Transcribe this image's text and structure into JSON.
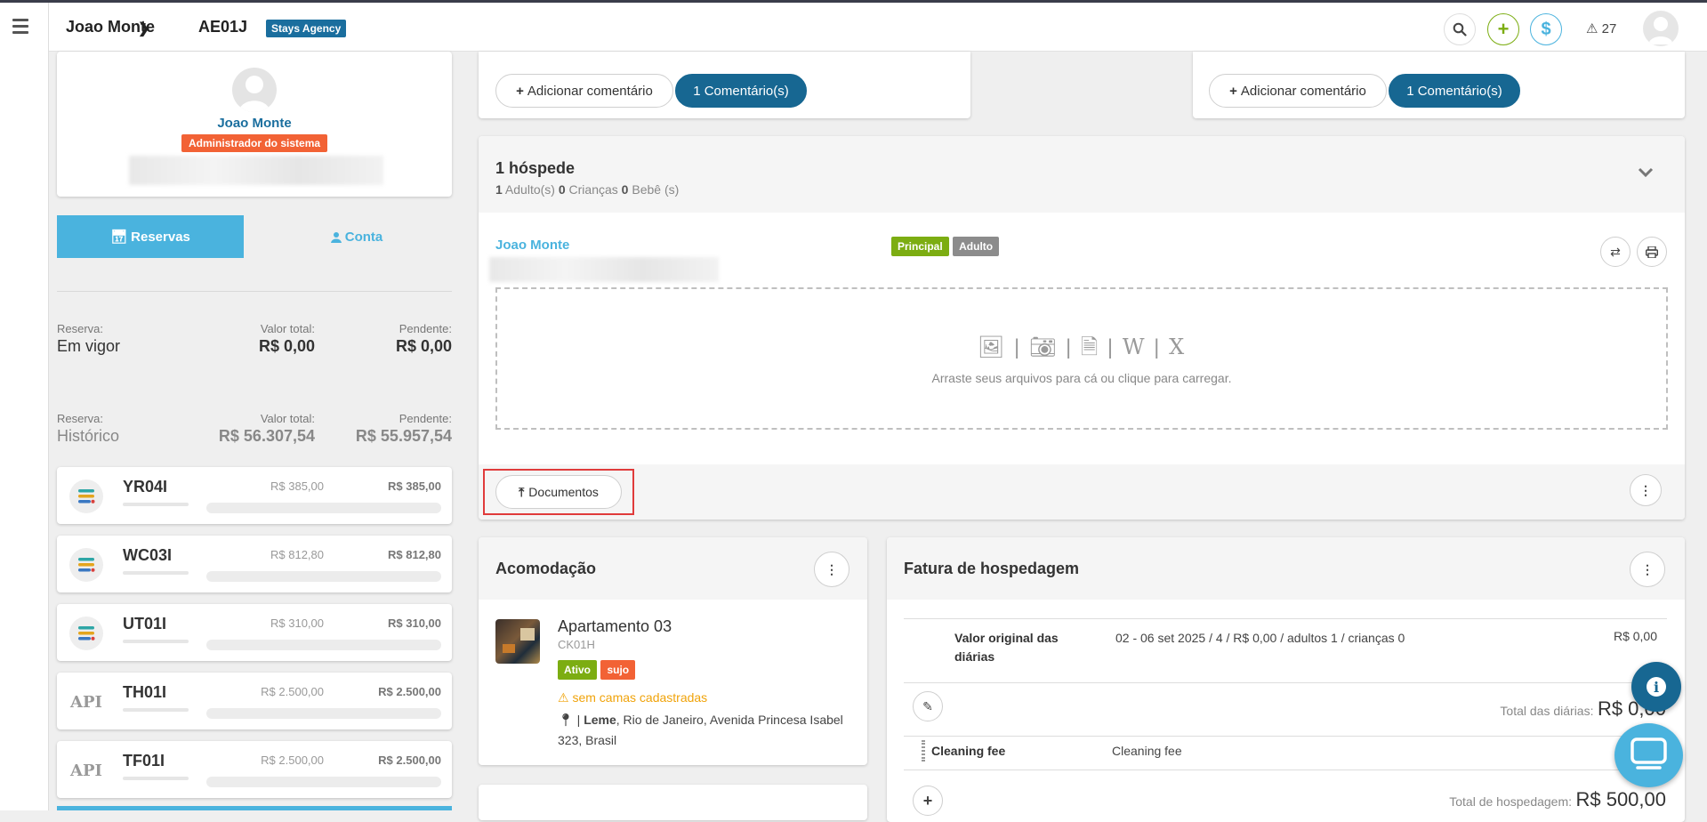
{
  "header": {
    "user_name": "Joao Monte",
    "reservation_code": "AE01J",
    "agency_badge": "Stays Agency",
    "alert_count": "27"
  },
  "profile": {
    "name": "Joao Monte",
    "role": "Administrador do sistema"
  },
  "tabs": {
    "reservas": "Reservas",
    "conta": "Conta"
  },
  "summary_current": {
    "reserva_label": "Reserva:",
    "reserva_value": "Em vigor",
    "total_label": "Valor total:",
    "total_value": "R$ 0,00",
    "pending_label": "Pendente:",
    "pending_value": "R$ 0,00"
  },
  "summary_history": {
    "reserva_label": "Reserva:",
    "reserva_value": "Histórico",
    "total_label": "Valor total:",
    "total_value": "R$ 56.307,54",
    "pending_label": "Pendente:",
    "pending_value": "R$ 55.957,54"
  },
  "properties": [
    {
      "code": "YR04I",
      "v1": "R$ 385,00",
      "v2": "R$ 385,00",
      "icon": "stack-icon"
    },
    {
      "code": "WC03I",
      "v1": "R$ 812,80",
      "v2": "R$ 812,80",
      "icon": "stack-icon"
    },
    {
      "code": "UT01I",
      "v1": "R$ 310,00",
      "v2": "R$ 310,00",
      "icon": "stack-icon"
    },
    {
      "code": "TH01I",
      "v1": "R$ 2.500,00",
      "v2": "R$ 2.500,00",
      "icon": "api-icon",
      "icon_text": "API"
    },
    {
      "code": "TF01I",
      "v1": "R$ 2.500,00",
      "v2": "R$ 2.500,00",
      "icon": "api-icon",
      "icon_text": "API"
    }
  ],
  "comments_left": {
    "add": "Adicionar comentário",
    "count": "1 Comentário(s)"
  },
  "comments_right": {
    "add": "Adicionar comentário",
    "count": "1 Comentário(s)"
  },
  "guests": {
    "title": "1 hóspede",
    "adults_n": "1",
    "adults_label": "Adulto(s)",
    "children_n": "0",
    "children_label": "Crianças",
    "babies_n": "0",
    "babies_label": "Bebê (s)",
    "guest_name": "Joao Monte",
    "tag_principal": "Principal",
    "tag_adulto": "Adulto",
    "upload_text": "Arraste seus arquivos para cá ou clique para carregar.",
    "documents_button": "Documentos"
  },
  "accommodation": {
    "title": "Acomodação",
    "name": "Apartamento 03",
    "code": "CK01H",
    "tag_ativo": "Ativo",
    "tag_sujo": "sujo",
    "warning": "sem camas cadastradas",
    "address_bold": "Leme",
    "address_rest": ", Rio de Janeiro, Avenida Princesa Isabel 323, Brasil"
  },
  "invoice": {
    "title": "Fatura de hospedagem",
    "row1_label": "Valor original das diárias",
    "row1_desc": "02 - 06 set 2025  /  4 /  R$ 0,00  /  adultos 1 / crianças 0",
    "row1_value": "R$ 0,00",
    "total_diarias_label": "Total das diárias:",
    "total_diarias_value": "R$ 0,00",
    "fee_label": "Cleaning fee",
    "fee_desc": "Cleaning fee",
    "fee_value": "R$",
    "total_label": "Total de hospedagem:",
    "total_value": "R$ 500,00"
  },
  "colors": {
    "primary": "#176792",
    "tab_active": "#4ab3de",
    "green": "#7cad12",
    "orange": "#f26235",
    "warning": "#f0a30a",
    "highlight": "#e03b3b"
  }
}
